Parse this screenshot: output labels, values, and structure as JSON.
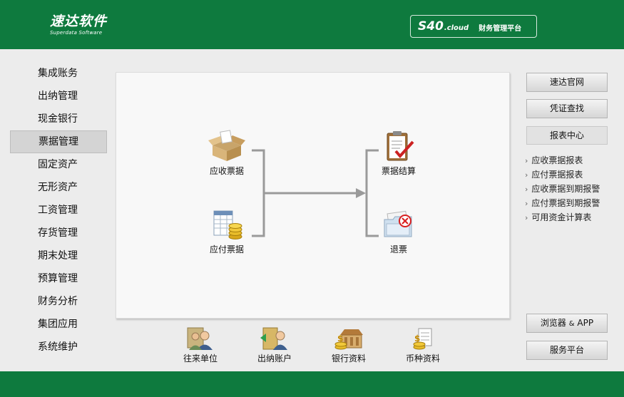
{
  "header": {
    "logo_cn": "速达软件",
    "logo_en": "Superdata Software",
    "platform_brand": "S40",
    "platform_cloud": ".cloud",
    "platform_name": "财务管理平台"
  },
  "sidebar": {
    "items": [
      {
        "label": "集成账务"
      },
      {
        "label": "出纳管理"
      },
      {
        "label": "现金银行"
      },
      {
        "label": "票据管理",
        "active": true
      },
      {
        "label": "固定资产"
      },
      {
        "label": "无形资产"
      },
      {
        "label": "工资管理"
      },
      {
        "label": "存货管理"
      },
      {
        "label": "期末处理"
      },
      {
        "label": "预算管理"
      },
      {
        "label": "财务分析"
      },
      {
        "label": "集团应用"
      },
      {
        "label": "系统维护"
      }
    ]
  },
  "flow": {
    "receivable": {
      "label": "应收票据",
      "icon": "open-box-icon"
    },
    "payable": {
      "label": "应付票据",
      "icon": "spreadsheet-coins-icon"
    },
    "settle": {
      "label": "票据结算",
      "icon": "clipboard-check-icon"
    },
    "refund": {
      "label": "退票",
      "icon": "folder-cancel-icon"
    }
  },
  "quick_links": [
    {
      "label": "往来单位",
      "icon": "contacts-icon"
    },
    {
      "label": "出纳账户",
      "icon": "cashier-account-icon"
    },
    {
      "label": "银行资料",
      "icon": "bank-icon"
    },
    {
      "label": "币种资料",
      "icon": "currency-icon"
    }
  ],
  "right": {
    "official_site": "速达官网",
    "voucher_search": "凭证查找",
    "report_center": "报表中心",
    "reports": [
      "应收票据报表",
      "应付票据报表",
      "应收票据到期报警",
      "应付票据到期报警",
      "可用资金计算表"
    ],
    "browser_app_a": "浏览器",
    "browser_app_amp": "&",
    "browser_app_b": "APP",
    "service_platform": "服务平台"
  },
  "colors": {
    "brand_green": "#0e7a3e",
    "panel_bg": "#f8f8f8",
    "page_bg": "#ececec"
  }
}
